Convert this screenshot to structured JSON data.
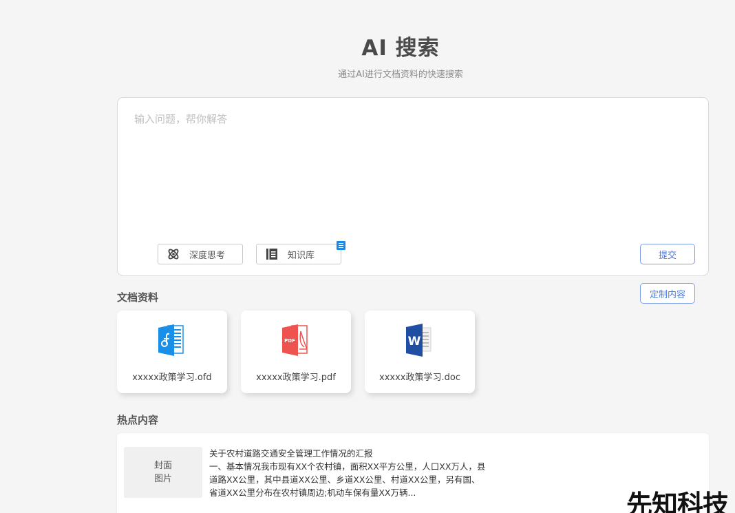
{
  "header": {
    "title": "AI 搜索",
    "subtitle": "通过AI进行文档资料的快速搜索"
  },
  "search": {
    "placeholder": "输入问题，帮你解答",
    "deep_think_label": "深度思考",
    "knowledge_base_label": "知识库",
    "submit_label": "提交"
  },
  "documents": {
    "section_title": "文档资料",
    "custom_label": "定制内容",
    "items": [
      {
        "name": "xxxxx政策学习.ofd",
        "icon": "ofd-file-icon",
        "color": "#1a8fe8"
      },
      {
        "name": "xxxxx政策学习.pdf",
        "icon": "pdf-file-icon",
        "color": "#ef5350"
      },
      {
        "name": "xxxxx政策学习.doc",
        "icon": "word-file-icon",
        "color": "#1f4ea3"
      }
    ]
  },
  "hot": {
    "section_title": "热点内容",
    "items": [
      {
        "cover_line1": "封面",
        "cover_line2": "图片",
        "title": "关于农村道路交通安全管理工作情况的汇报",
        "line1": "一、基本情况我市现有XX个农村镇，面积XX平方公里，人口XX万人，县",
        "line2": "道路XX公里，其中县道XX公里、乡道XX公里、村道XX公里，另有国、",
        "line3": "省道XX公里分布在农村镇周边;机动车保有量XX万辆..."
      }
    ]
  },
  "watermark": "先知科技",
  "colors": {
    "accent": "#4f7ad8",
    "badge": "#1e88e5"
  }
}
